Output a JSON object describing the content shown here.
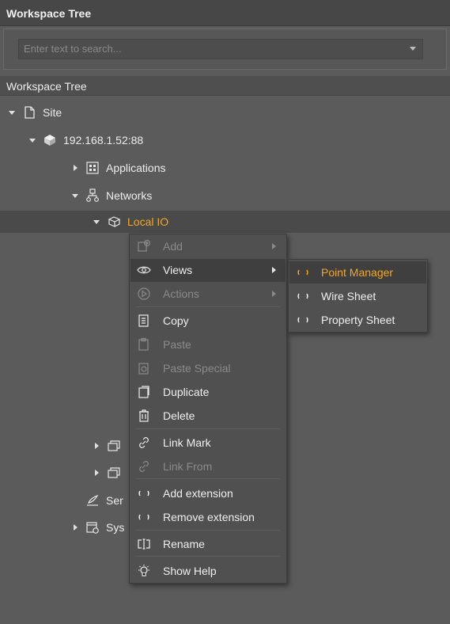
{
  "panel": {
    "title": "Workspace Tree"
  },
  "search": {
    "placeholder": "Enter text to search..."
  },
  "section_label": "Workspace Tree",
  "tree": {
    "site": "Site",
    "host": "192.168.1.52:88",
    "applications": "Applications",
    "networks": "Networks",
    "local_io": "Local IO",
    "partial_ser": "Ser",
    "partial_sys": "Sys"
  },
  "context_menu": {
    "items": [
      {
        "label": "Add",
        "icon": "add-icon",
        "disabled": true
      },
      {
        "label": "Views",
        "icon": "eye-icon",
        "disabled": false
      },
      {
        "label": "Actions",
        "icon": "play-icon",
        "disabled": true
      },
      {
        "label": "Copy",
        "icon": "copy-icon",
        "disabled": false
      },
      {
        "label": "Paste",
        "icon": "paste-icon",
        "disabled": true
      },
      {
        "label": "Paste Special",
        "icon": "paste-special-icon",
        "disabled": true
      },
      {
        "label": "Duplicate",
        "icon": "duplicate-icon",
        "disabled": false
      },
      {
        "label": "Delete",
        "icon": "trash-icon",
        "disabled": false
      },
      {
        "label": "Link Mark",
        "icon": "link-icon",
        "disabled": false
      },
      {
        "label": "Link From",
        "icon": "link-icon",
        "disabled": true
      },
      {
        "label": "Add extension",
        "icon": "loading-icon",
        "disabled": false
      },
      {
        "label": "Remove extension",
        "icon": "loading-icon",
        "disabled": false
      },
      {
        "label": "Rename",
        "icon": "rename-icon",
        "disabled": false
      },
      {
        "label": "Show Help",
        "icon": "help-bulb-icon",
        "disabled": false
      }
    ]
  },
  "views_submenu": {
    "items": [
      {
        "label": "Point Manager",
        "icon": "loading-icon"
      },
      {
        "label": "Wire Sheet",
        "icon": "loading-icon"
      },
      {
        "label": "Property Sheet",
        "icon": "loading-icon"
      }
    ]
  },
  "colors": {
    "accent": "#f5a623",
    "background": "#5b5b5b",
    "menu_bg": "#505050"
  }
}
